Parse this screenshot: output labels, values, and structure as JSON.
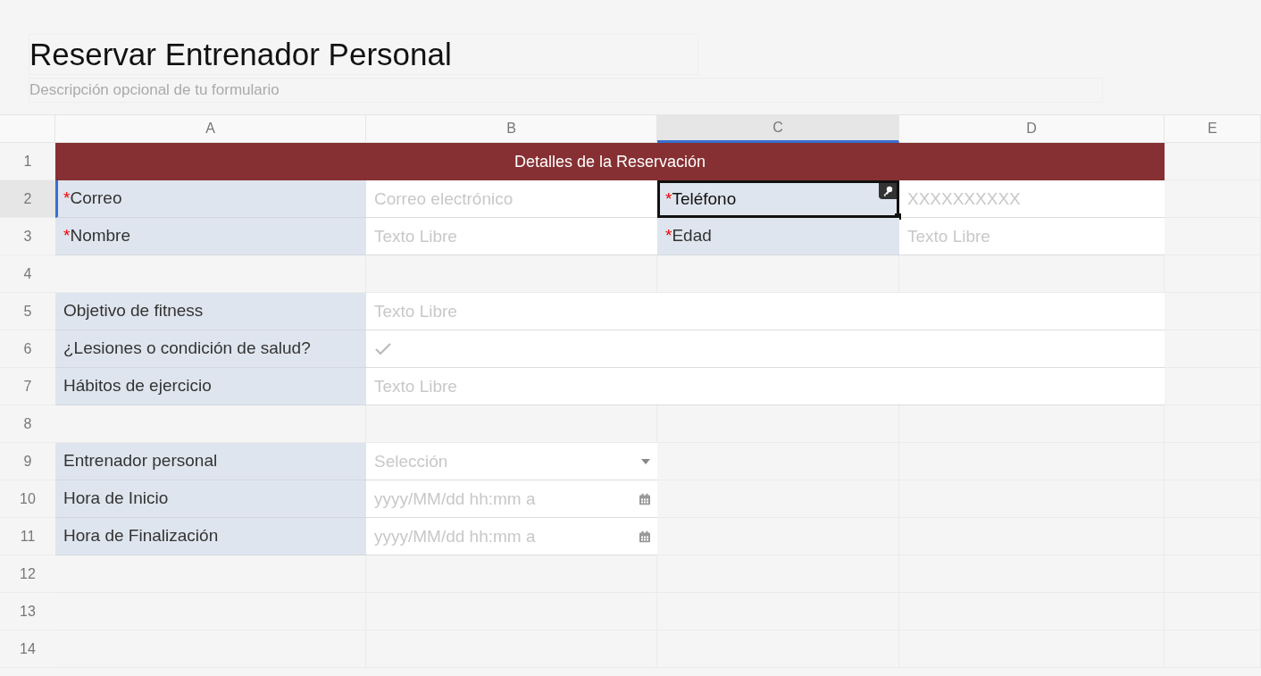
{
  "form": {
    "title": "Reservar Entrenador Personal",
    "description_placeholder": "Descripción opcional de tu formulario"
  },
  "columns": [
    {
      "label": "A",
      "selected": false
    },
    {
      "label": "B",
      "selected": false
    },
    {
      "label": "C",
      "selected": true
    },
    {
      "label": "D",
      "selected": false
    },
    {
      "label": "E",
      "selected": false
    }
  ],
  "rows": [
    {
      "number": "1",
      "selected": false,
      "cells": [
        {
          "kind": "banner",
          "text": "Detalles de la Reservación",
          "selected": false
        }
      ]
    },
    {
      "number": "2",
      "selected": true,
      "cells": [
        {
          "kind": "label",
          "text": "Correo",
          "required_mark": "*",
          "selected": false
        },
        {
          "kind": "text",
          "placeholder": "Correo electrónico",
          "selected": false
        },
        {
          "kind": "label",
          "text": "Teléfono",
          "required_mark": "*",
          "selected": true
        },
        {
          "kind": "text",
          "placeholder": "XXXXXXXXXX",
          "selected": false
        }
      ]
    },
    {
      "number": "3",
      "selected": false,
      "cells": [
        {
          "kind": "label",
          "text": "Nombre",
          "required_mark": "*",
          "selected": false
        },
        {
          "kind": "text",
          "placeholder": "Texto Libre",
          "selected": false
        },
        {
          "kind": "label",
          "text": "Edad",
          "required_mark": "*",
          "selected": false
        },
        {
          "kind": "text",
          "placeholder": "Texto Libre",
          "selected": false
        }
      ]
    },
    {
      "number": "4",
      "selected": false
    },
    {
      "number": "5",
      "selected": false,
      "cells": [
        {
          "kind": "label",
          "text": "Objetivo de fitness",
          "selected": false
        },
        {
          "kind": "text_wide",
          "placeholder": "Texto Libre",
          "selected": false
        }
      ]
    },
    {
      "number": "6",
      "selected": false,
      "cells": [
        {
          "kind": "label",
          "text": "¿Lesiones o condición de salud?",
          "selected": false
        },
        {
          "kind": "check",
          "checked": false,
          "selected": false
        }
      ]
    },
    {
      "number": "7",
      "selected": false,
      "cells": [
        {
          "kind": "label",
          "text": "Hábitos de ejercicio",
          "selected": false
        },
        {
          "kind": "text_wide",
          "placeholder": "Texto Libre",
          "selected": false
        }
      ]
    },
    {
      "number": "8",
      "selected": false
    },
    {
      "number": "9",
      "selected": false,
      "cells": [
        {
          "kind": "label",
          "text": "Entrenador personal",
          "selected": false
        },
        {
          "kind": "select",
          "placeholder": "Selección",
          "selected": false
        }
      ]
    },
    {
      "number": "10",
      "selected": false,
      "cells": [
        {
          "kind": "label",
          "text": "Hora de Inicio",
          "selected": false
        },
        {
          "kind": "date",
          "placeholder": "yyyy/MM/dd hh:mm a",
          "selected": false
        }
      ]
    },
    {
      "number": "11",
      "selected": false,
      "cells": [
        {
          "kind": "label",
          "text": "Hora de Finalización",
          "selected": false
        },
        {
          "kind": "date",
          "placeholder": "yyyy/MM/dd hh:mm a",
          "selected": false
        }
      ]
    },
    {
      "number": "12",
      "selected": false
    },
    {
      "number": "13",
      "selected": false
    },
    {
      "number": "14",
      "selected": false
    }
  ]
}
